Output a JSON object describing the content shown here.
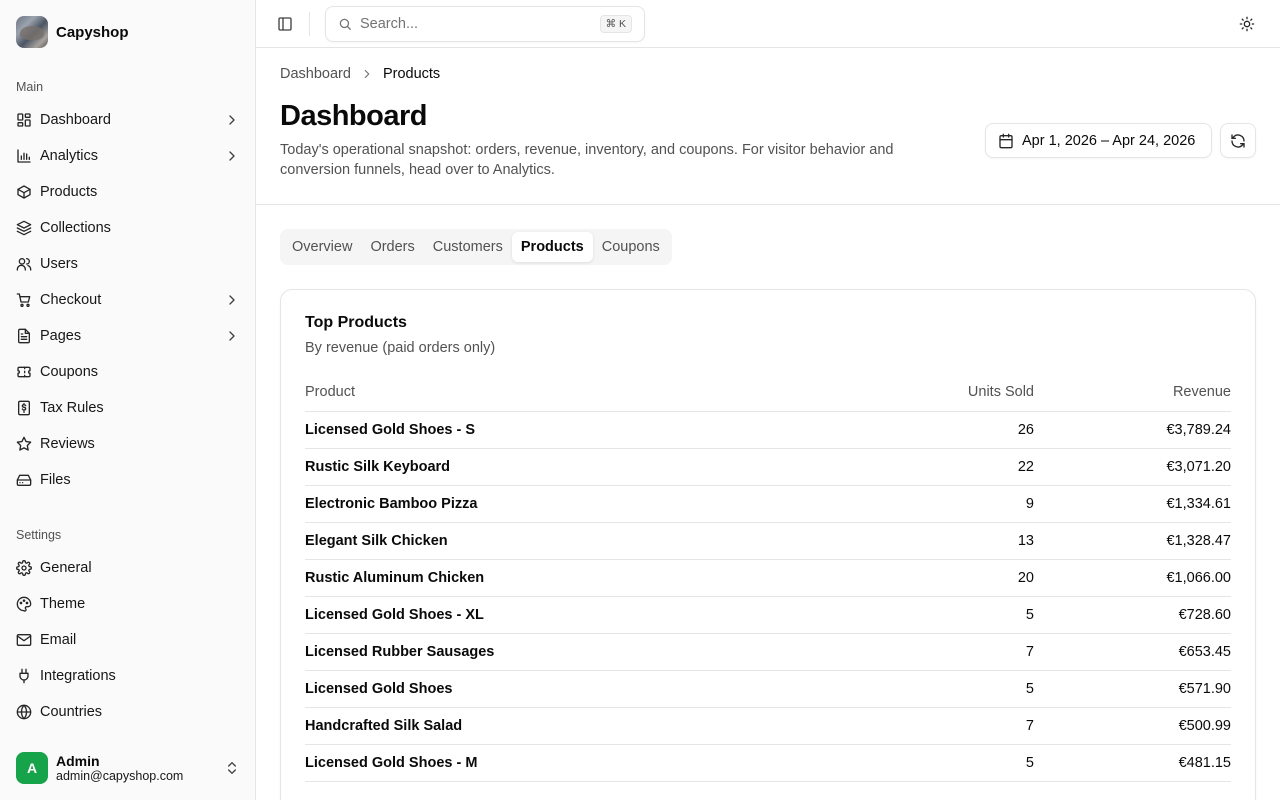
{
  "brand": {
    "name": "Capyshop"
  },
  "sidebar": {
    "main_label": "Main",
    "main_items": [
      {
        "label": "Dashboard",
        "icon": "dashboard-icon",
        "chevron": true
      },
      {
        "label": "Analytics",
        "icon": "chart-icon",
        "chevron": true
      },
      {
        "label": "Products",
        "icon": "package-icon",
        "chevron": false
      },
      {
        "label": "Collections",
        "icon": "layers-icon",
        "chevron": false
      },
      {
        "label": "Users",
        "icon": "users-icon",
        "chevron": false
      },
      {
        "label": "Checkout",
        "icon": "cart-icon",
        "chevron": true
      },
      {
        "label": "Pages",
        "icon": "file-icon",
        "chevron": true
      },
      {
        "label": "Coupons",
        "icon": "ticket-icon",
        "chevron": false
      },
      {
        "label": "Tax Rules",
        "icon": "receipt-icon",
        "chevron": false
      },
      {
        "label": "Reviews",
        "icon": "star-icon",
        "chevron": false
      },
      {
        "label": "Files",
        "icon": "drive-icon",
        "chevron": false
      }
    ],
    "settings_label": "Settings",
    "settings_items": [
      {
        "label": "General",
        "icon": "gear-icon"
      },
      {
        "label": "Theme",
        "icon": "palette-icon"
      },
      {
        "label": "Email",
        "icon": "mail-icon"
      },
      {
        "label": "Integrations",
        "icon": "plug-icon"
      },
      {
        "label": "Countries",
        "icon": "globe-icon"
      }
    ],
    "user": {
      "initial": "A",
      "name": "Admin",
      "email": "admin@capyshop.com"
    }
  },
  "topbar": {
    "search_placeholder": "Search...",
    "search_shortcut": "⌘ K"
  },
  "breadcrumb": {
    "parent": "Dashboard",
    "current": "Products"
  },
  "header": {
    "title": "Dashboard",
    "description": "Today's operational snapshot: orders, revenue, inventory, and coupons. For visitor behavior and conversion funnels, head over to Analytics.",
    "date_range": "Apr 1, 2026 – Apr 24, 2026"
  },
  "tabs": [
    {
      "label": "Overview",
      "active": false
    },
    {
      "label": "Orders",
      "active": false
    },
    {
      "label": "Customers",
      "active": false
    },
    {
      "label": "Products",
      "active": true
    },
    {
      "label": "Coupons",
      "active": false
    }
  ],
  "card": {
    "title": "Top Products",
    "subtitle": "By revenue (paid orders only)",
    "columns": [
      "Product",
      "Units Sold",
      "Revenue"
    ],
    "rows": [
      {
        "product": "Licensed Gold Shoes - S",
        "units": "26",
        "revenue": "€3,789.24"
      },
      {
        "product": "Rustic Silk Keyboard",
        "units": "22",
        "revenue": "€3,071.20"
      },
      {
        "product": "Electronic Bamboo Pizza",
        "units": "9",
        "revenue": "€1,334.61"
      },
      {
        "product": "Elegant Silk Chicken",
        "units": "13",
        "revenue": "€1,328.47"
      },
      {
        "product": "Rustic Aluminum Chicken",
        "units": "20",
        "revenue": "€1,066.00"
      },
      {
        "product": "Licensed Gold Shoes - XL",
        "units": "5",
        "revenue": "€728.60"
      },
      {
        "product": "Licensed Rubber Sausages",
        "units": "7",
        "revenue": "€653.45"
      },
      {
        "product": "Licensed Gold Shoes",
        "units": "5",
        "revenue": "€571.90"
      },
      {
        "product": "Handcrafted Silk Salad",
        "units": "7",
        "revenue": "€500.99"
      },
      {
        "product": "Licensed Gold Shoes - M",
        "units": "5",
        "revenue": "€481.15"
      }
    ]
  },
  "colors": {
    "accent": "#0a0a0a",
    "muted_text": "#525252",
    "border": "#e5e5e5",
    "sidebar_bg": "#fafafa",
    "avatar_bg": "#16a34a"
  }
}
